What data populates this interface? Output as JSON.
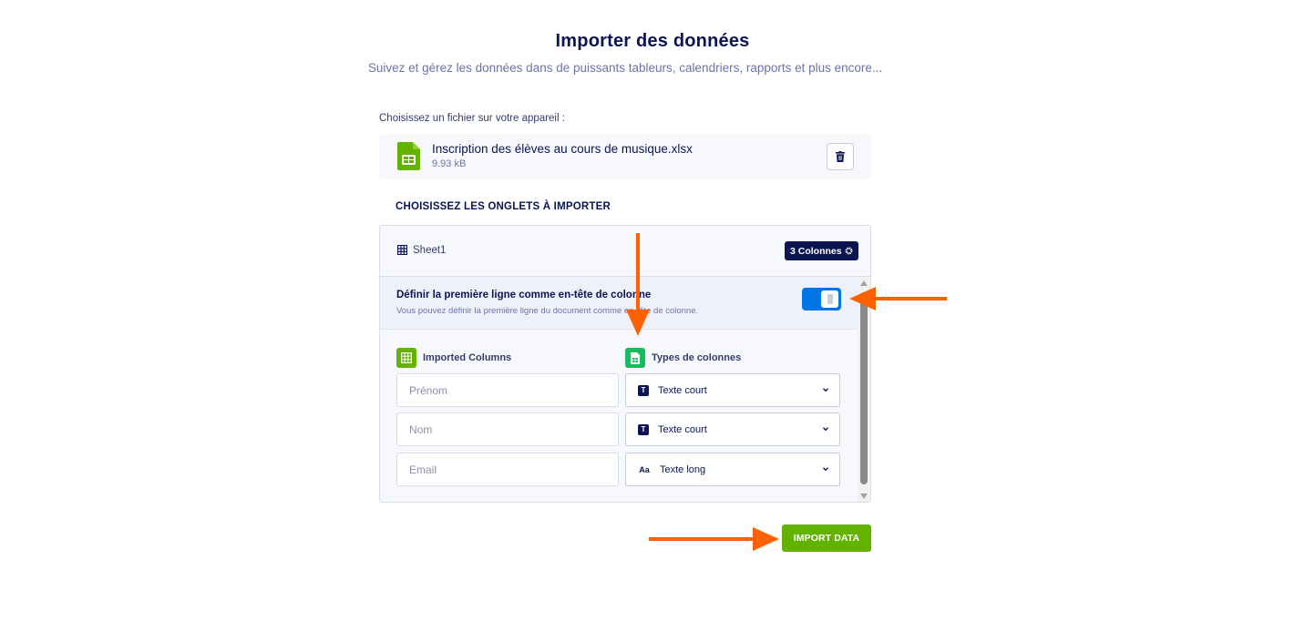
{
  "header": {
    "title": "Importer des données",
    "subtitle": "Suivez et gérez les données dans de puissants tableurs, calendriers, rapports et plus encore..."
  },
  "upload": {
    "choose_label": "Choisissez un fichier sur votre appareil :",
    "file_name": "Inscription des élèves au cours de musique.xlsx",
    "file_size": "9.93 kB"
  },
  "tabs": {
    "heading": "CHOISISSEZ LES ONGLETS À IMPORTER",
    "sheet_name": "Sheet1",
    "columns_badge": "3 Colonnes"
  },
  "header_option": {
    "title": "Définir la première ligne comme en-tête de colonne",
    "description": "Vous pouvez définir la première ligne du document comme en-tête de colonne.",
    "enabled": true
  },
  "mapping": {
    "imported_heading": "Imported Columns",
    "types_heading": "Types de colonnes",
    "rows": [
      {
        "column": "Prénom",
        "type": "Texte court",
        "type_icon": "T"
      },
      {
        "column": "Nom",
        "type": "Texte court",
        "type_icon": "T"
      },
      {
        "column": "Email",
        "type": "Texte long",
        "type_icon": "Aa"
      }
    ]
  },
  "actions": {
    "import_label": "IMPORT DATA"
  },
  "colors": {
    "primary_text": "#0a1551",
    "accent_green": "#64b200",
    "toggle_blue": "#0075e3",
    "annotation_arrow": "#ff6100"
  }
}
